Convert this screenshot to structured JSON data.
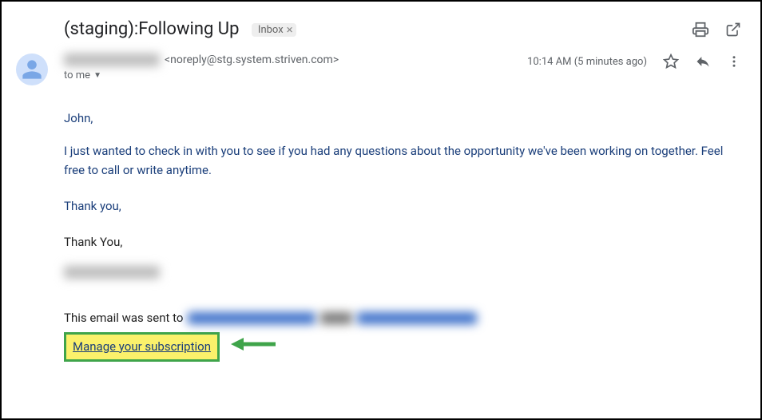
{
  "header": {
    "subject": "(staging):Following Up",
    "inbox_label": "Inbox"
  },
  "meta": {
    "sender_email": "<noreply@stg.system.striven.com>",
    "recipient_label": "to me",
    "timestamp": "10:14 AM (5 minutes ago)"
  },
  "body": {
    "greeting": "John,",
    "paragraph": "I just wanted to check in with you to see if you had any questions about the opportunity we've been working on together. Feel free to call or write anytime.",
    "closing": "Thank you,",
    "signature_label": "Thank You,"
  },
  "footer": {
    "sent_to_prefix": "This email was sent to",
    "manage_link": "Manage your subscription"
  }
}
